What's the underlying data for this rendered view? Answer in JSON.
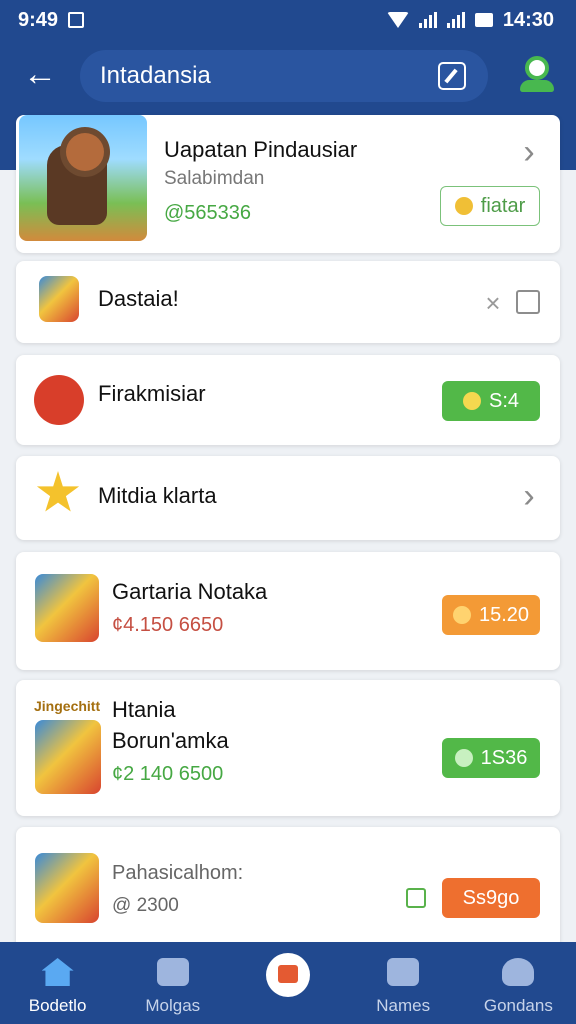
{
  "status_bar": {
    "time_left": "9:49",
    "time_right": "14:30"
  },
  "header": {
    "title": "Intadansia"
  },
  "items": [
    {
      "title": "Uapatan Pindausiar",
      "subtitle": "Salabimdan",
      "price": "@565336",
      "action": "fiatar"
    },
    {
      "title": "Dastaia!"
    },
    {
      "title": "Firakmisiar",
      "action": "S:4"
    },
    {
      "title": "Mitdia klarta"
    },
    {
      "title": "Gartaria Notaka",
      "price": "¢4.150 6650",
      "action": "15.20"
    },
    {
      "label": "Jingechitt",
      "title_line1": "Htania",
      "title_line2": "Borun'amka",
      "price": "¢2 140 6500",
      "action": "1S36"
    },
    {
      "title": "Pahasicalhom:",
      "price": "@ 2300",
      "action": "Ss9go"
    }
  ],
  "bottom_nav": [
    {
      "label": "Bodetlo"
    },
    {
      "label": "Molgas"
    },
    {
      "label": ""
    },
    {
      "label": "Names"
    },
    {
      "label": "Gondans"
    }
  ],
  "colors": {
    "primary": "#21498f",
    "green": "#52b848",
    "orange": "#f39a36",
    "red_orange": "#ee6f2f"
  },
  "icons": {
    "back": "back-arrow-icon",
    "edit": "edit-icon",
    "profile": "profile-icon",
    "chevron": "chevron-right-icon",
    "close": "close-icon",
    "share": "share-icon"
  }
}
